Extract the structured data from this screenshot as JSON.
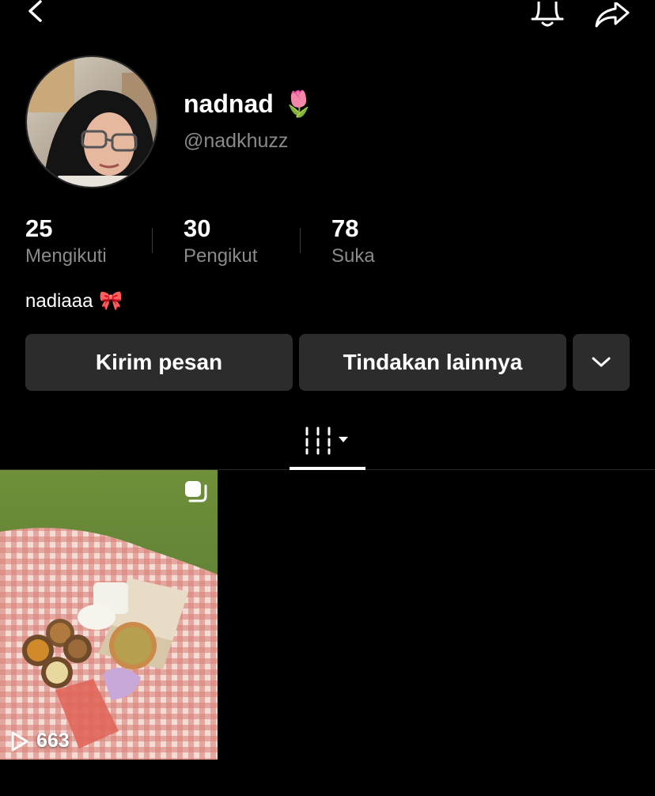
{
  "profile": {
    "display_name": "nadnad",
    "name_emoji": "🌷",
    "handle": "@nadkhuzz",
    "bio_text": "nadiaaa",
    "bio_emoji": "🎀"
  },
  "stats": [
    {
      "value": "25",
      "label": "Mengikuti"
    },
    {
      "value": "30",
      "label": "Pengikut"
    },
    {
      "value": "78",
      "label": "Suka"
    }
  ],
  "actions": {
    "message_label": "Kirim pesan",
    "more_label": "Tindakan lainnya"
  },
  "icons": {
    "back": "chevron-left-icon",
    "bell": "bell-icon",
    "share": "share-icon",
    "dropdown": "chevron-down-icon",
    "grid_tab": "grid-icon",
    "multi": "multi-photo-icon",
    "play": "play-icon"
  },
  "videos": [
    {
      "views": "663"
    }
  ],
  "colors": {
    "background": "#000000",
    "button_bg": "#2c2c2c",
    "secondary_text": "#8a8a8a"
  }
}
